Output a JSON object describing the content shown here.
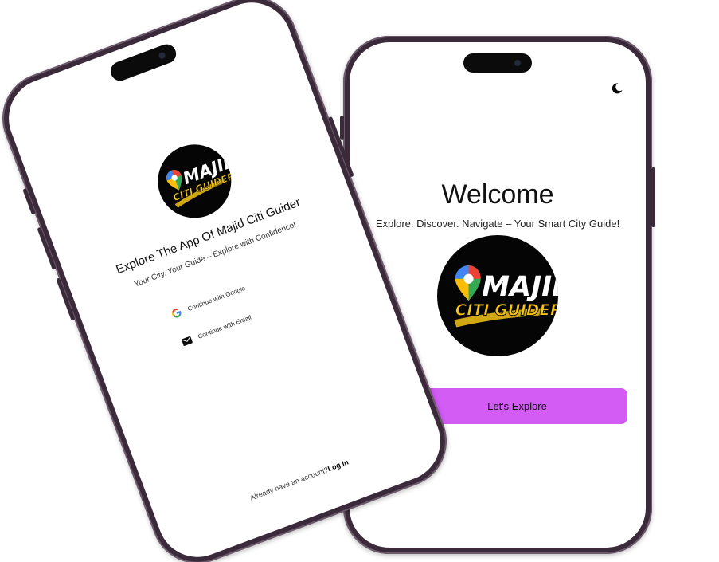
{
  "welcome_screen": {
    "title": "Welcome",
    "subtitle": "Explore. Discover. Navigate – Your Smart City Guide!",
    "explore_button_label": "Let's Explore",
    "theme_toggle_icon": "moon-icon",
    "accent_color": "#d35cf5"
  },
  "login_screen": {
    "title": "Explore The App Of Majid Citi Guider",
    "subtitle": "Your City, Your Guide – Explore with Confidence!",
    "google_button_label": "Continue with Google",
    "google_icon": "google-icon",
    "email_button_label": "Continue with Email",
    "email_icon": "mail-icon",
    "account_prompt": "Already have an account?",
    "login_link": "Log in"
  },
  "logo": {
    "line1": "MAJID",
    "line2": "CITI GUIDER",
    "icon": "map-pin-icon",
    "background_color": "#050505",
    "text_color_top": "#ffffff",
    "text_color_bottom": "#f5c518"
  }
}
